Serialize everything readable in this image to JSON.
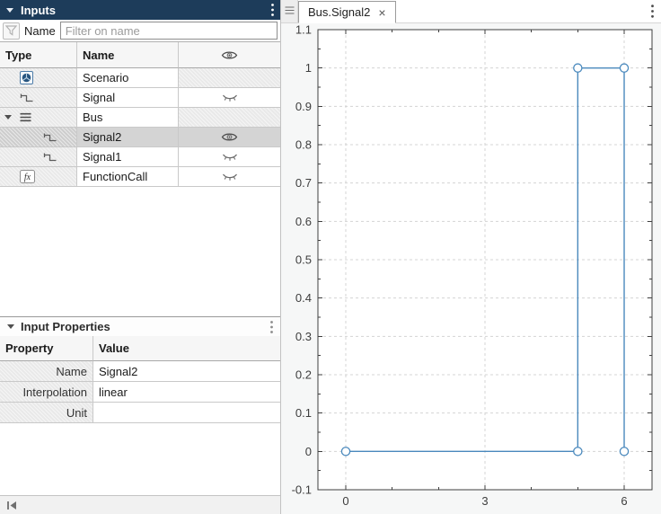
{
  "colors": {
    "accent_header": "#1d3c5a",
    "line_blue": "#4a89bd",
    "selection_gray": "#d4d4d4"
  },
  "inputs_panel": {
    "title": "Inputs",
    "filter": {
      "label": "Name",
      "placeholder": "Filter on name"
    },
    "tree_table": {
      "col_type": "Type",
      "col_name": "Name",
      "col_visibility_icon": "eye-icon",
      "rows": [
        {
          "name": "Scenario",
          "type_icon": "scenario-icon",
          "eye": "none",
          "depth": 0,
          "expander": false,
          "selected": false
        },
        {
          "name": "Signal",
          "type_icon": "signal-icon",
          "eye": "closed",
          "depth": 0,
          "expander": false,
          "selected": false
        },
        {
          "name": "Bus",
          "type_icon": "bus-icon",
          "eye": "none",
          "depth": 0,
          "expander": true,
          "selected": false
        },
        {
          "name": "Signal2",
          "type_icon": "signal-icon",
          "eye": "open",
          "depth": 1,
          "expander": false,
          "selected": true
        },
        {
          "name": "Signal1",
          "type_icon": "signal-icon",
          "eye": "closed",
          "depth": 1,
          "expander": false,
          "selected": false
        },
        {
          "name": "FunctionCall",
          "type_icon": "function-call-icon",
          "eye": "closed",
          "depth": 0,
          "expander": false,
          "selected": false
        }
      ]
    }
  },
  "properties_panel": {
    "title": "Input Properties",
    "col_property": "Property",
    "col_value": "Value",
    "rows": [
      {
        "property": "Name",
        "value": "Signal2"
      },
      {
        "property": "Interpolation",
        "value": "linear"
      },
      {
        "property": "Unit",
        "value": ""
      }
    ]
  },
  "plot_panel": {
    "tab_label": "Bus.Signal2",
    "close_label": "×"
  },
  "chart_data": {
    "type": "line",
    "title": "Bus.Signal2",
    "xlabel": "",
    "ylabel": "",
    "xlim": [
      -0.6,
      6.6
    ],
    "ylim": [
      -0.1,
      1.1
    ],
    "grid": "dashed",
    "legend": false,
    "x_ticks": [
      {
        "v": 0,
        "label": "0"
      },
      {
        "v": 3,
        "label": "3"
      },
      {
        "v": 6,
        "label": "6"
      }
    ],
    "y_ticks": [
      {
        "v": 1.1,
        "label": "1.1"
      },
      {
        "v": 1,
        "label": "1"
      },
      {
        "v": 0.9,
        "label": "0.9"
      },
      {
        "v": 0.8,
        "label": "0.8"
      },
      {
        "v": 0.7,
        "label": "0.7"
      },
      {
        "v": 0.6,
        "label": "0.6"
      },
      {
        "v": 0.5,
        "label": "0.5"
      },
      {
        "v": 0.4,
        "label": "0.4"
      },
      {
        "v": 0.3,
        "label": "0.3"
      },
      {
        "v": 0.2,
        "label": "0.2"
      },
      {
        "v": 0.1,
        "label": "0.1"
      },
      {
        "v": 0,
        "label": "0"
      },
      {
        "v": -0.1,
        "label": "-0.1"
      }
    ],
    "x_minor_ticks": [
      1,
      2,
      4,
      5
    ],
    "y_minor_ticks": [
      -0.05,
      0.05,
      0.15,
      0.25,
      0.35,
      0.45,
      0.55,
      0.65,
      0.75,
      0.85,
      0.95,
      1.05
    ],
    "series": [
      {
        "name": "Bus.Signal2",
        "x": [
          0,
          5,
          5,
          6,
          6
        ],
        "y": [
          0,
          0,
          1,
          1,
          0
        ],
        "color": "#4a89bd",
        "marker": "circle"
      }
    ]
  }
}
